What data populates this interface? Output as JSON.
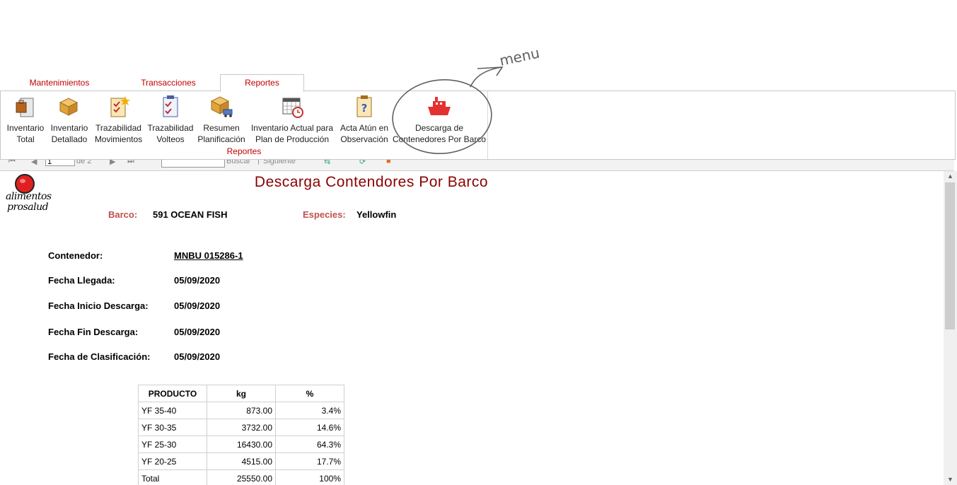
{
  "tabs": [
    {
      "label": "Mantenimientos"
    },
    {
      "label": "Transacciones"
    },
    {
      "label": "Reportes"
    }
  ],
  "ribbon": {
    "buttons": [
      {
        "label1": "Inventario",
        "label2": "Total",
        "icon": "clipboard-bag-icon"
      },
      {
        "label1": "Inventario",
        "label2": "Detallado",
        "icon": "boxes-icon"
      },
      {
        "label1": "Trazabilidad",
        "label2": "Movimientos",
        "icon": "checklist-star-icon"
      },
      {
        "label1": "Trazabilidad",
        "label2": "Volteos",
        "icon": "checklist-icon"
      },
      {
        "label1": "Resumen",
        "label2": "Planificación",
        "icon": "box-cart-icon"
      },
      {
        "label1": "Inventario Actual para",
        "label2": "Plan de Producción",
        "icon": "calendar-clock-icon"
      },
      {
        "label1": "Acta Atún en",
        "label2": "Observación",
        "icon": "question-clipboard-icon"
      },
      {
        "label1": "Descarga de",
        "label2": "Contenedores Por Barco",
        "icon": "ship-icon"
      }
    ],
    "group_label": "Reportes"
  },
  "annotation": {
    "text": "menu"
  },
  "toolbar": {
    "page_value": "1",
    "page_of": "de 2",
    "search_value": "",
    "find_label": "Buscar",
    "next_label": "Siguiente"
  },
  "report": {
    "logo_text_1": "alimentos",
    "logo_text_2": "prosalud",
    "title": "Descarga Contendores Por Barco",
    "barco_label": "Barco:",
    "barco_value": "591 OCEAN FISH",
    "especies_label": "Especies:",
    "especies_value": "Yellowfin",
    "fields": [
      {
        "label": "Contenedor:",
        "value": "MNBU 015286-1"
      },
      {
        "label": "Fecha Llegada:",
        "value": "05/09/2020"
      },
      {
        "label": "Fecha Inicio Descarga:",
        "value": "05/09/2020"
      },
      {
        "label": "Fecha Fin Descarga:",
        "value": "05/09/2020"
      },
      {
        "label": "Fecha de Clasificación:",
        "value": "05/09/2020"
      }
    ],
    "table": {
      "headers": [
        "PRODUCTO",
        "kg",
        "%"
      ],
      "rows": [
        [
          "YF 35-40",
          "873.00",
          "3.4%"
        ],
        [
          "YF 30-35",
          "3732.00",
          "14.6%"
        ],
        [
          "YF 25-30",
          "16430.00",
          "64.3%"
        ],
        [
          "YF 20-25",
          "4515.00",
          "17.7%"
        ],
        [
          "Total",
          "25550.00",
          "100%"
        ]
      ]
    }
  },
  "colors": {
    "accent_red": "#c00000",
    "title_red": "#8b0000",
    "label_red": "#c0504d"
  }
}
